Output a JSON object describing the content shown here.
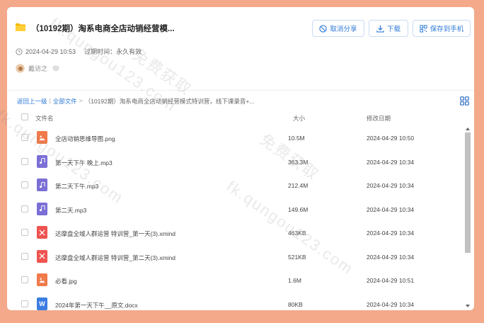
{
  "header": {
    "title": "（10192期）淘系电商全店动销经营模...",
    "date": "2024-04-29 10:53",
    "expiry": "过期时间：永久有效",
    "user_name": "戴访之"
  },
  "actions": {
    "cancel_share": "取消分享",
    "download": "下载",
    "save_to_phone": "保存到手机"
  },
  "breadcrumb": {
    "back": "返回上一级",
    "sep1": "|",
    "all_files": "全部文件",
    "sep2": ">",
    "current": "（10192期）淘系电商全店动销经营模式特训营，线下课录音+..."
  },
  "table": {
    "col_name": "文件名",
    "col_size": "大小",
    "col_date": "修改日期",
    "rows": [
      {
        "name": "全店动销思维导图.png",
        "size": "10.5M",
        "date": "2024-04-29 10:50",
        "type": "image"
      },
      {
        "name": "第一天下午 晚上.mp3",
        "size": "363.3M",
        "date": "2024-04-29 10:34",
        "type": "audio"
      },
      {
        "name": "第二天下午.mp3",
        "size": "212.4M",
        "date": "2024-04-29 10:34",
        "type": "audio"
      },
      {
        "name": "第二天.mp3",
        "size": "149.6M",
        "date": "2024-04-29 10:34",
        "type": "audio"
      },
      {
        "name": "达摩盘全域人群运营 特训营_第一天(3).xmind",
        "size": "463KB",
        "date": "2024-04-29 10:34",
        "type": "xmind"
      },
      {
        "name": "达摩盘全域人群运营 特训营_第二天(3).xmind",
        "size": "521KB",
        "date": "2024-04-29 10:34",
        "type": "xmind"
      },
      {
        "name": "必看.jpg",
        "size": "1.6M",
        "date": "2024-04-29 10:51",
        "type": "image"
      },
      {
        "name": "2024年第一天下午__原文.docx",
        "size": "80KB",
        "date": "2024-04-29 10:34",
        "type": "word"
      }
    ]
  },
  "watermarks": [
    "fk.qungou123.com",
    "免费获取",
    "fk.qungou123.com",
    "免费获取",
    "fk.qungou123.com"
  ],
  "colors": {
    "background": "#f3a98a",
    "accent": "#2f7bd6",
    "image_icon": "#f07a4b",
    "audio_icon": "#7b6fd6",
    "xmind_icon": "#ef5350",
    "word_icon": "#3b7de1"
  }
}
